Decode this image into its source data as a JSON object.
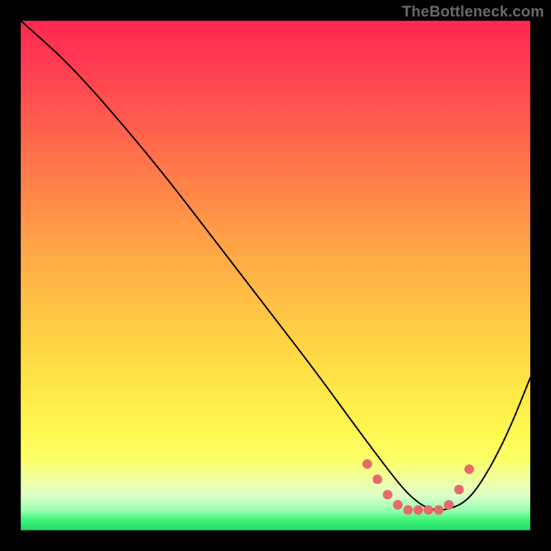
{
  "watermark": "TheBottleneck.com",
  "chart_data": {
    "type": "line",
    "title": "",
    "xlabel": "",
    "ylabel": "",
    "xlim": [
      0,
      100
    ],
    "ylim": [
      0,
      100
    ],
    "background_gradient": {
      "top": "#ff2850",
      "mid": "#ffd644",
      "bottom": "#24d868"
    },
    "series": [
      {
        "name": "bottleneck-curve",
        "color": "#000000",
        "x": [
          0,
          9,
          18,
          28,
          38,
          48,
          58,
          66,
          72,
          76,
          80,
          84,
          88,
          92,
          96,
          100
        ],
        "y": [
          100,
          92,
          82,
          70,
          57,
          44,
          31,
          20,
          12,
          7,
          4,
          4,
          6,
          12,
          20,
          30
        ]
      }
    ],
    "highlight": {
      "name": "optimal-range",
      "color": "#e66a6a",
      "x": [
        68,
        70,
        72,
        74,
        76,
        78,
        80,
        82,
        84,
        86,
        88
      ],
      "y": [
        13,
        10,
        7,
        5,
        4,
        4,
        4,
        4,
        5,
        8,
        12
      ]
    }
  }
}
